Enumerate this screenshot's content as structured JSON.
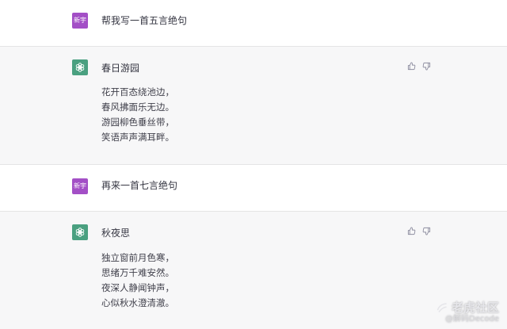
{
  "conversation": {
    "user_avatar_label": "新宇",
    "messages": [
      {
        "role": "user",
        "text": "帮我写一首五言绝句"
      },
      {
        "role": "assistant",
        "title": "春日游园",
        "lines": [
          "花开百态绕池边，",
          "春风拂面乐无边。",
          "游园柳色垂丝带，",
          "笑语声声满耳畔。"
        ]
      },
      {
        "role": "user",
        "text": "再来一首七言绝句"
      },
      {
        "role": "assistant",
        "title": "秋夜思",
        "lines": [
          "独立窗前月色寒，",
          "思绪万千难安然。",
          "夜深人静闻钟声，",
          "心似秋水澄清澈。"
        ]
      }
    ]
  },
  "icons": {
    "assistant_avatar": "openai-logo-icon",
    "feedback": [
      "thumbs-up-icon",
      "thumbs-down-icon"
    ]
  },
  "colors": {
    "user_avatar_bg": "#a34fc6",
    "assistant_avatar_bg": "#4aa080",
    "assistant_row_bg": "#f7f7f8"
  },
  "watermark": {
    "main": "老虎社区",
    "sub": "@解码Decode"
  }
}
